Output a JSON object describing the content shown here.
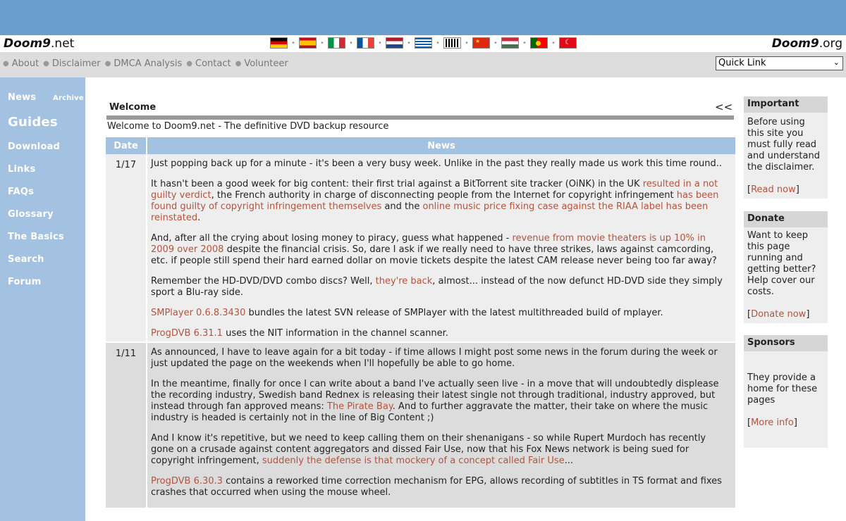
{
  "header": {
    "logo_left_bold": "Doom9",
    "logo_left_rest": ".net",
    "logo_right_bold": "Doom9",
    "logo_right_rest": ".org",
    "flags": [
      "german-flag",
      "spanish-flag",
      "italian-flag",
      "french-flag",
      "dutch-flag",
      "greek-flag",
      "japanese-flag",
      "chinese-flag",
      "hungarian-flag",
      "portuguese-flag",
      "turkish-flag"
    ]
  },
  "menu": {
    "items": [
      "About",
      "Disclaimer",
      "DMCA Analysis",
      "Contact",
      "Volunteer"
    ],
    "quick_link": "Quick Link"
  },
  "sidebar": {
    "news": "News",
    "archive": "Archive",
    "guides": "Guides",
    "download": "Download",
    "links": "Links",
    "faqs": "FAQs",
    "glossary": "Glossary",
    "basics": "The Basics",
    "search": "Search",
    "forum": "Forum"
  },
  "welcome": {
    "title": "Welcome",
    "collapse": "<<",
    "text": "Welcome to Doom9.net - The definitive DVD backup resource"
  },
  "news": {
    "col_date": "Date",
    "col_news": "News",
    "entries": [
      {
        "date": "1/17",
        "p1": "Just popping back up for a minute - it's been a very busy week. Unlike in the past they really made us work this time round..",
        "p2a": "It hasn't been a good week for big content: their first trial against a BitTorrent site tracker (OiNK) in the UK ",
        "p2l1": "resulted in a not guilty verdict",
        "p2b": ", the French authority in charge of disconnecting people from the Internet for copyright infringement ",
        "p2l2": "has been found guilty of copyright infringement themselves",
        "p2c": " and the ",
        "p2l3": "online music price fixing case against the RIAA label has been reinstated",
        "p2d": ".",
        "p3a": "And, after all the crying about losing money to piracy, guess what happened - ",
        "p3l": "revenue from movie theaters is up 10% in 2009 over 2008",
        "p3b": " despite the financial crisis. So, dare I ask if we really need to have three strikes, laws against camcording, etc. if people still spend their hard earned dollar on movie tickets despite the latest CAM release never being too far away?",
        "p4a": "Remember the HD-DVD/DVD combo discs? Well, ",
        "p4l": "they're back",
        "p4b": ", almost... instead of the now defunct HD-DVD side they simply sport a Blu-ray side.",
        "p5l": "SMPlayer 0.6.8.3430",
        "p5b": " bundles the latest SVN release of SMPlayer with the latest multithreaded build of mplayer.",
        "p6l": "ProgDVB 6.31.1",
        "p6b": " uses the NIT information in the channel scanner."
      },
      {
        "date": "1/11",
        "p1": "As announced, I have to leave again for a bit today - if time allows I might post some news in the forum during the week or just updated the page on the weekends when I'll hopefully be able to go home.",
        "p2a": "In the meantime, finally for once I can write about a band I've actually seen live - in a move that will undoubtedly displease the recording industry, Swedish band Rednex is releasing their latest single not through traditional, industry approved, but instead through fan approved means: ",
        "p2l": "The Pirate Bay",
        "p2b": ". And to further aggravate the matter, their take on where the music industry is headed is certainly not in the line of Big Content ;)",
        "p3a": "And I know it's repetitive, but we need to keep calling them on their shenanigans - so while Rupert Murdoch has recently gone on a crusade against content aggregators and dissed Fair Use, now that his Fox News network is being sued for copyright infringement, ",
        "p3l": "suddenly the defense is that mockery of a concept called Fair Use",
        "p3b": "...",
        "p4l": "ProgDVB 6.30.3",
        "p4b": " contains a reworked time correction mechanism for EPG, allows recording of subtitles in TS format and fixes crashes that occurred when using the mouse wheel."
      }
    ]
  },
  "boxes": {
    "important_title": "Important",
    "important_text": "Before using this site you must fully read and understand the disclaimer.",
    "important_link": "Read now",
    "donate_title": "Donate",
    "donate_text": "Want to keep this page running and getting better? Help cover our costs.",
    "donate_link": "Donate now",
    "sponsors_title": "Sponsors",
    "sponsors_text": "They provide a home for these pages",
    "sponsors_link": "More info",
    "bracket_open": "[",
    "bracket_close": "]"
  }
}
